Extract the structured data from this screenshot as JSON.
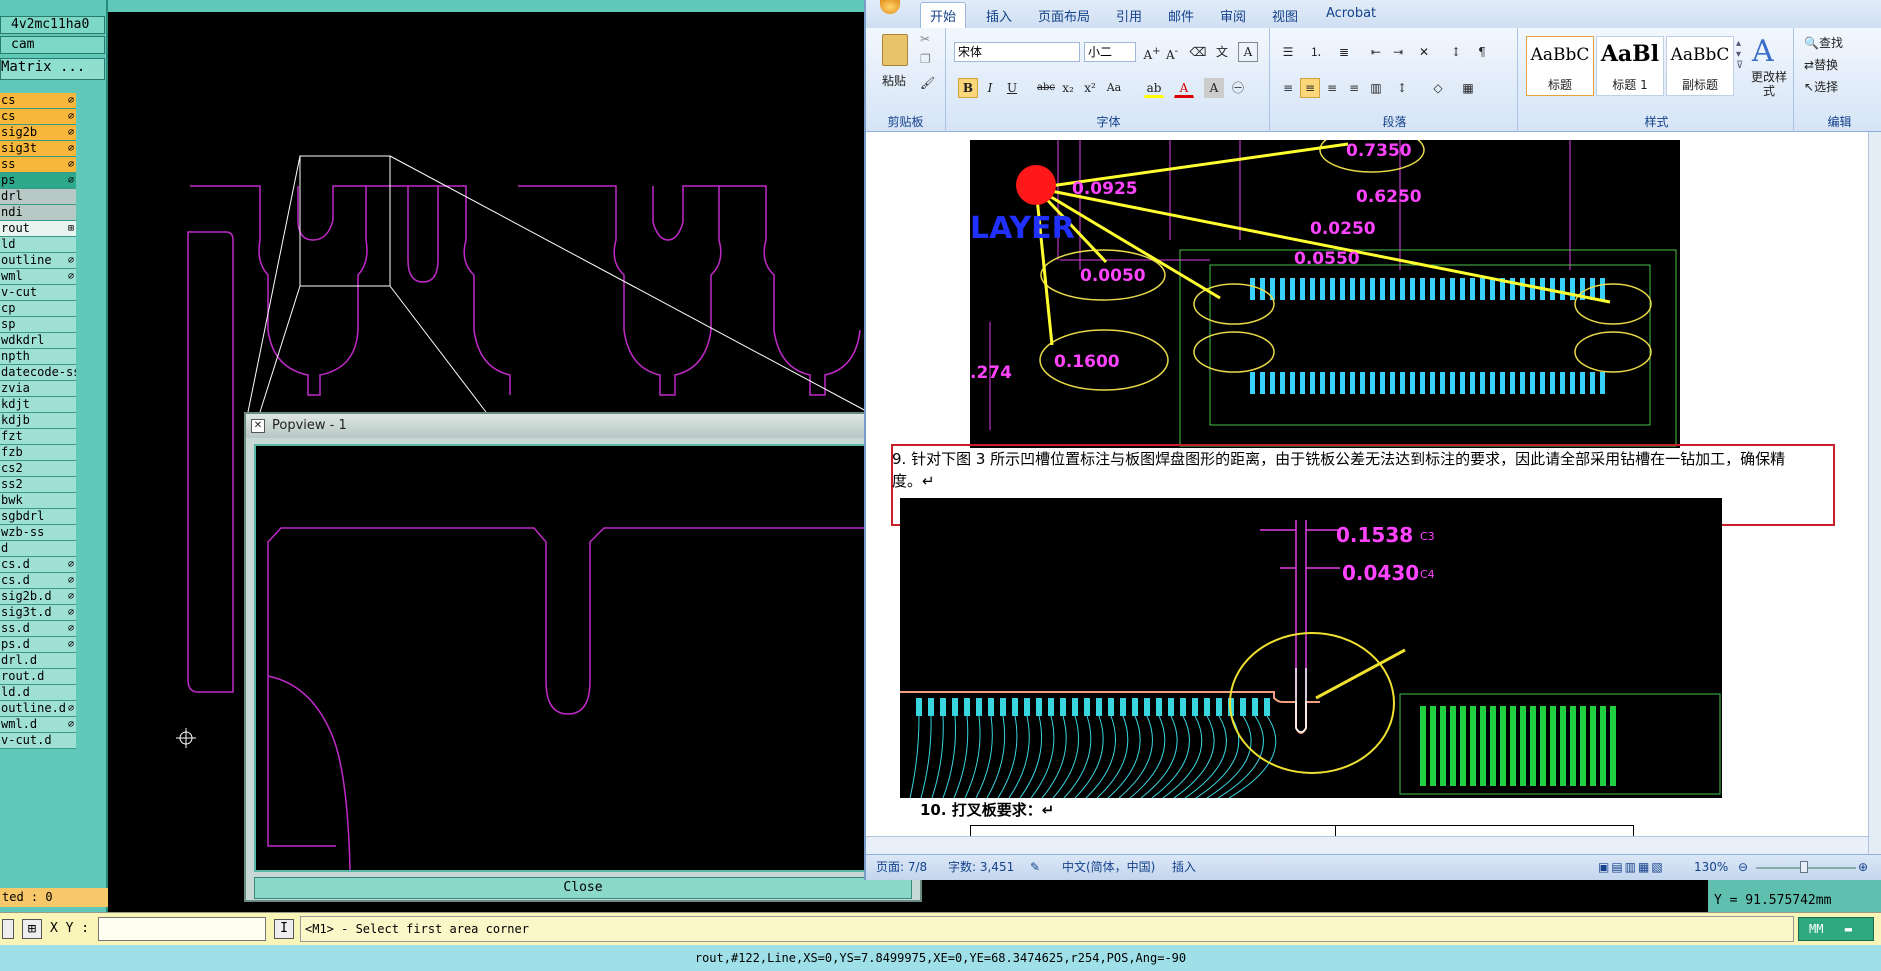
{
  "cam": {
    "job_name": "4v2mc11ha0",
    "step_name": "cam",
    "matrix_button": "Matrix ...",
    "layers": [
      {
        "label": "cs",
        "color": "orange",
        "mark": "⌀"
      },
      {
        "label": "cs",
        "color": "orange",
        "mark": "⌀"
      },
      {
        "label": "sig2b",
        "color": "orange",
        "mark": "⌀"
      },
      {
        "label": "sig3t",
        "color": "orange",
        "mark": "⌀"
      },
      {
        "label": "ss",
        "color": "orange",
        "mark": "⌀"
      },
      {
        "label": "ps",
        "color": "green",
        "mark": "⌀"
      },
      {
        "label": "drl",
        "color": "grey",
        "mark": ""
      },
      {
        "label": "ndi",
        "color": "grey",
        "mark": ""
      },
      {
        "label": "rout",
        "color": "white",
        "mark": "⊞"
      },
      {
        "label": "ld",
        "color": "light",
        "mark": ""
      },
      {
        "label": "outline",
        "color": "light",
        "mark": "⌀"
      },
      {
        "label": "wml",
        "color": "light",
        "mark": "⌀"
      },
      {
        "label": "v-cut",
        "color": "light",
        "mark": ""
      },
      {
        "label": "cp",
        "color": "light",
        "mark": ""
      },
      {
        "label": "sp",
        "color": "light",
        "mark": ""
      },
      {
        "label": "wdkdrl",
        "color": "light",
        "mark": ""
      },
      {
        "label": "npth",
        "color": "light",
        "mark": ""
      },
      {
        "label": "datecode-ss",
        "color": "light",
        "mark": ""
      },
      {
        "label": "zvia",
        "color": "light",
        "mark": ""
      },
      {
        "label": "kdjt",
        "color": "light",
        "mark": ""
      },
      {
        "label": "kdjb",
        "color": "light",
        "mark": ""
      },
      {
        "label": "fzt",
        "color": "light",
        "mark": ""
      },
      {
        "label": "fzb",
        "color": "light",
        "mark": ""
      },
      {
        "label": "cs2",
        "color": "light",
        "mark": ""
      },
      {
        "label": "ss2",
        "color": "light",
        "mark": ""
      },
      {
        "label": "bwk",
        "color": "light",
        "mark": ""
      },
      {
        "label": "sgbdrl",
        "color": "light",
        "mark": ""
      },
      {
        "label": "wzb-ss",
        "color": "light",
        "mark": ""
      },
      {
        "label": "d",
        "color": "light",
        "mark": ""
      },
      {
        "label": "cs.d",
        "color": "light",
        "mark": "⌀"
      },
      {
        "label": "cs.d",
        "color": "light",
        "mark": "⌀"
      },
      {
        "label": "sig2b.d",
        "color": "light",
        "mark": "⌀"
      },
      {
        "label": "sig3t.d",
        "color": "light",
        "mark": "⌀"
      },
      {
        "label": "ss.d",
        "color": "light",
        "mark": "⌀"
      },
      {
        "label": "ps.d",
        "color": "light",
        "mark": "⌀"
      },
      {
        "label": "drl.d",
        "color": "light",
        "mark": ""
      },
      {
        "label": "rout.d",
        "color": "light",
        "mark": ""
      },
      {
        "label": "ld.d",
        "color": "light",
        "mark": ""
      },
      {
        "label": "outline.d",
        "color": "light",
        "mark": "⌀"
      },
      {
        "label": "wml.d",
        "color": "light",
        "mark": "⌀"
      },
      {
        "label": "v-cut.d",
        "color": "light",
        "mark": ""
      }
    ],
    "selected_count": "ted : 0",
    "popview_title": "Popview - 1",
    "popview_close": "Close",
    "xy_label": "X Y :",
    "xy_input": "",
    "prompt": "<M1> - Select first area corner",
    "units": "MM",
    "y_readout": "Y = 91.575742mm",
    "status_line": "rout,#122,Line,XS=0,YS=7.8499975,XE=0,YE=68.3474625,r254,POS,Ang=-90"
  },
  "word": {
    "tabs": [
      "开始",
      "插入",
      "页面布局",
      "引用",
      "邮件",
      "审阅",
      "视图",
      "Acrobat"
    ],
    "clipboard_group": "剪贴板",
    "paste_label": "粘贴",
    "font_group": "字体",
    "font_name": "宋体",
    "font_size": "小二",
    "paragraph_group": "段落",
    "styles_group": "样式",
    "styles": [
      {
        "sample": "AaBbC",
        "name": "标题"
      },
      {
        "sample": "AaBl",
        "name": "标题 1"
      },
      {
        "sample": "AaBbC",
        "name": "副标题"
      }
    ],
    "change_styles": "更改样式",
    "edit_group": "编辑",
    "find": "查找",
    "replace": "替换",
    "select": "选择",
    "paragraph9": "9. 针对下图 3 所示凹槽位置标注与板图焊盘图形的距离，由于铣板公差无法达到标注的要求，因此请全部采用钻槽在一钻加工，确保精度。↵",
    "heading10": "10. 打叉板要求：↵",
    "fig1_dims": [
      "0.7350",
      "0.0925",
      "0.6250",
      "0.0250",
      "0.0550",
      "0.0050",
      "0.1600",
      ".274"
    ],
    "fig1_layer": "LAYER",
    "fig2_dims": [
      "0.1538",
      "0.0430"
    ],
    "fig2_tags": [
      "C3",
      "C4"
    ],
    "status_page": "页面: 7/8",
    "status_words": "字数: 3,451",
    "status_lang": "中文(简体，中国)",
    "status_insert": "插入",
    "zoom": "130%"
  }
}
